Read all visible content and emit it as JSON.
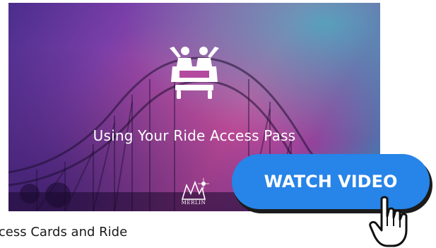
{
  "video": {
    "title": "Using Your Ride Access Pass",
    "logo_text": "MERLIN"
  },
  "cta": {
    "label": "WATCH VIDEO"
  },
  "caption": {
    "text": "ccess Cards and Ride"
  },
  "icons": {
    "ride": "roller-coaster-car-icon",
    "cursor": "hand-pointer-icon",
    "logo": "merlin-logo-icon"
  },
  "colors": {
    "button": "#2784e8",
    "button_shadow": "#1b1b1b",
    "thumb_purple": "#7a3fa8",
    "thumb_magenta": "#c24a9a",
    "thumb_teal": "#2f8fb5"
  }
}
